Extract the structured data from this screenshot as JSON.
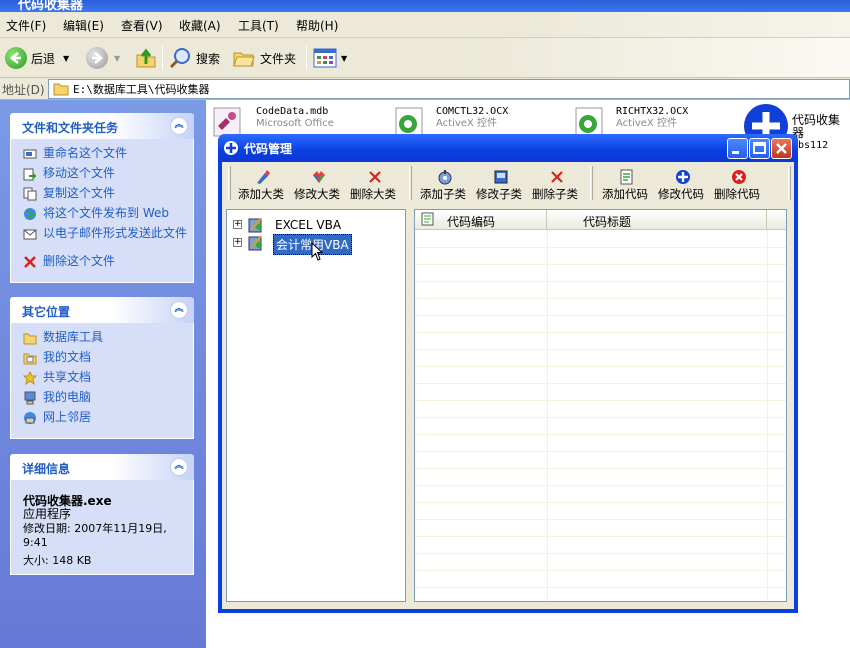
{
  "window": {
    "title": "代码收集器"
  },
  "menu": [
    "文件(F)",
    "编辑(E)",
    "查看(V)",
    "收藏(A)",
    "工具(T)",
    "帮助(H)"
  ],
  "toolbar": {
    "back": "后退",
    "search": "搜索",
    "folders": "文件夹"
  },
  "address": {
    "label": "地址(D)",
    "path": "E:\\数据库工具\\代码收集器"
  },
  "tasks": {
    "title": "文件和文件夹任务",
    "items": [
      "重命名这个文件",
      "移动这个文件",
      "复制这个文件",
      "将这个文件发布到 Web",
      "以电子邮件形式发送此文件",
      "删除这个文件"
    ]
  },
  "places": {
    "title": "其它位置",
    "items": [
      "数据库工具",
      "我的文档",
      "共享文档",
      "我的电脑",
      "网上邻居"
    ]
  },
  "details": {
    "title": "详细信息",
    "name": "代码收集器.exe",
    "type": "应用程序",
    "modified": "修改日期: 2007年11月19日, 9:41",
    "size": "大小: 148 KB"
  },
  "files": [
    {
      "name": "CodeData.mdb",
      "sub": "Microsoft Office"
    },
    {
      "name": "COMCTL32.OCX",
      "sub": "ActiveX 控件"
    },
    {
      "name": "RICHTX32.OCX",
      "sub": "ActiveX 控件"
    },
    {
      "name": "代码收集器",
      "sub": "zbs112"
    }
  ],
  "dialog": {
    "title": "代码管理",
    "buttons": [
      "添加大类",
      "修改大类",
      "删除大类",
      "添加子类",
      "修改子类",
      "删除子类",
      "添加代码",
      "修改代码",
      "删除代码"
    ],
    "tree": [
      "EXCEL VBA",
      "会计常用VBA"
    ],
    "columns": [
      "代码编码",
      "代码标题"
    ]
  },
  "colors": {
    "taskpane": "#6c86dc",
    "dialog_title": "#0a3fe0",
    "link": "#215dc6"
  }
}
